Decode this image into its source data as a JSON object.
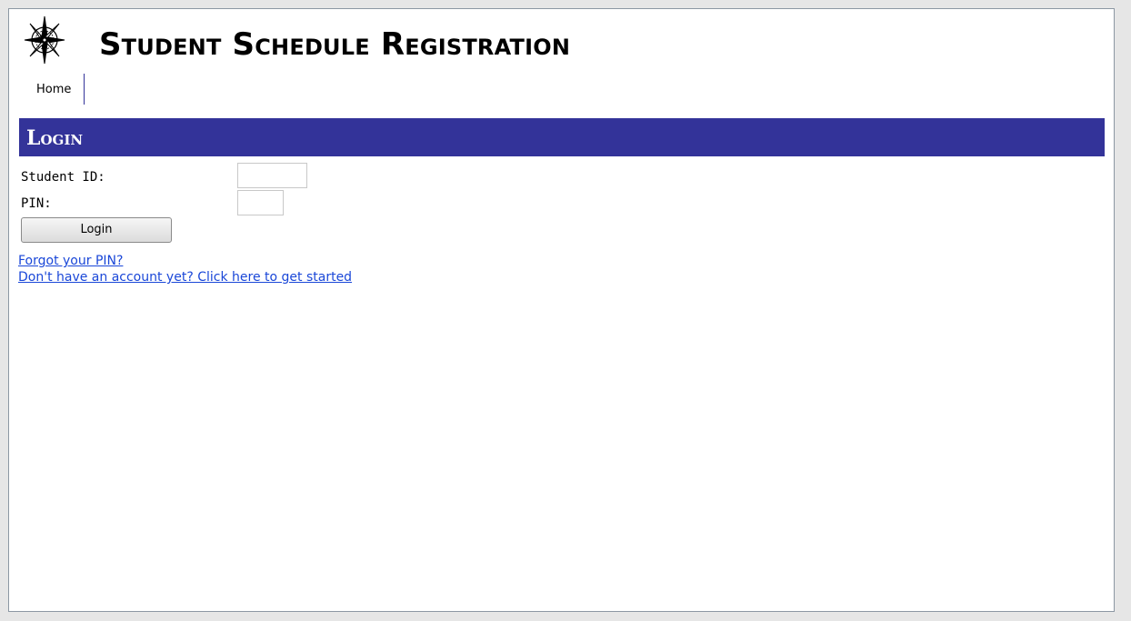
{
  "header": {
    "title": "Student Schedule Registration",
    "logo_icon": "compass-rose-icon"
  },
  "nav": {
    "items": [
      {
        "label": "Home"
      }
    ]
  },
  "login": {
    "section_title": "Login",
    "student_id_label": "Student ID:",
    "student_id_value": "",
    "pin_label": "PIN:",
    "pin_value": "",
    "button_label": "Login",
    "forgot_pin_link": "Forgot your PIN?",
    "signup_link": "Don't have an account yet? Click here to get started"
  },
  "colors": {
    "section_bar": "#333399",
    "link": "#1a47d8",
    "frame_border": "#8c97a3",
    "page_background": "#e6e6e6"
  }
}
